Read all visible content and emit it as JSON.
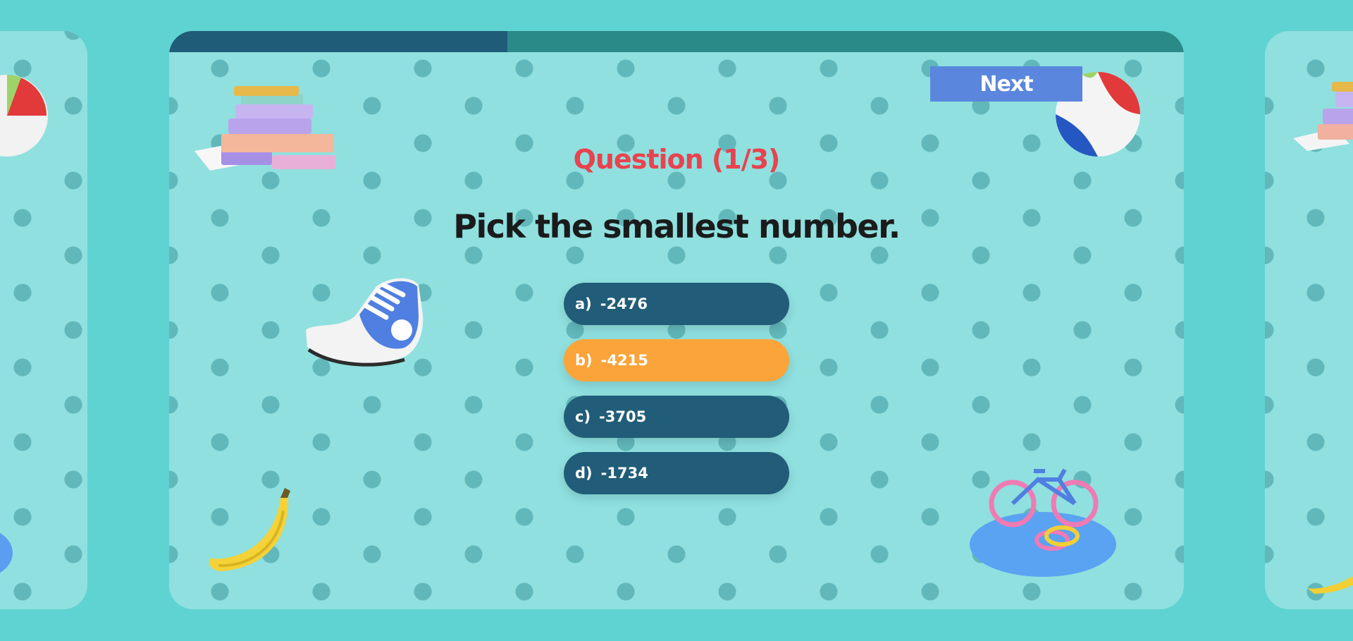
{
  "progress": {
    "fraction": 0.333
  },
  "next_label": "Next",
  "question": {
    "number_label": "Question (1/3)",
    "text": "Pick the smallest number."
  },
  "answers": [
    {
      "letter": "a)",
      "value": "-2476",
      "selected": false
    },
    {
      "letter": "b)",
      "value": "-4215",
      "selected": true
    },
    {
      "letter": "c)",
      "value": "-3705",
      "selected": false
    },
    {
      "letter": "d)",
      "value": "-1734",
      "selected": false
    }
  ],
  "colors": {
    "page_background": "#5fd3d1",
    "card_background": "#8fe0df",
    "progress_fill": "#1f5c78",
    "progress_track": "#2a8a88",
    "next_button": "#5b86dd",
    "question_number": "#e8434e",
    "answer_default": "#215d78",
    "answer_selected": "#fba43a"
  },
  "decorations": [
    "books-icon",
    "sneaker-icon",
    "banana-icon",
    "beach-ball-icon",
    "bicycle-icon"
  ]
}
